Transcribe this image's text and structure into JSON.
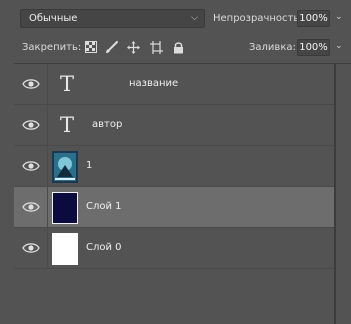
{
  "options": {
    "blend_mode": "Обычные",
    "opacity_label": "Непрозрачность:",
    "opacity_value": "100%",
    "lock_label": "Закрепить:",
    "fill_label": "Заливка:",
    "fill_value": "100%"
  },
  "lock_icons": [
    "lock-transparent-pixels-icon",
    "lock-image-pixels-icon",
    "lock-position-icon",
    "lock-artboard-icon",
    "lock-all-icon"
  ],
  "layers": [
    {
      "type": "text",
      "name": "название",
      "visible": true,
      "selected": false
    },
    {
      "type": "text",
      "name": "автор",
      "visible": true,
      "selected": false
    },
    {
      "type": "image",
      "name": "1",
      "visible": true,
      "selected": false
    },
    {
      "type": "fill",
      "name": "Слой 1",
      "visible": true,
      "selected": true,
      "thumb_color": "#0b0b3f"
    },
    {
      "type": "fill",
      "name": "Слой 0",
      "visible": true,
      "selected": false,
      "thumb_color": "#ffffff"
    }
  ],
  "colors": {
    "panel_bg": "#535353",
    "selected_row": "#6d6d6d",
    "field_bg": "#454545"
  }
}
